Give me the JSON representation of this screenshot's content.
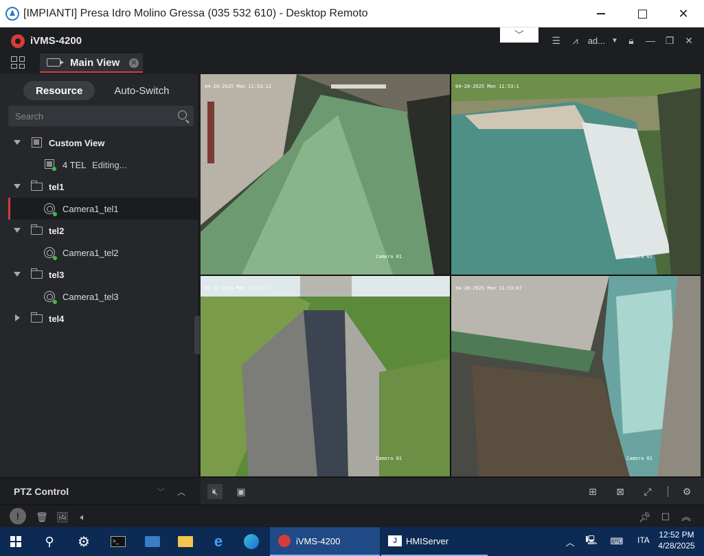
{
  "remote_window": {
    "title": "[IMPIANTI] Presa Idro Molino Gressa (035 532 610) - Desktop Remoto",
    "controls": [
      "minimize-icon",
      "maximize-icon",
      "close-icon"
    ]
  },
  "app": {
    "name": "iVMS-4200",
    "user": "ad...",
    "tab": {
      "label": "Main View"
    }
  },
  "sidebar": {
    "segments": [
      {
        "label": "Resource",
        "active": true
      },
      {
        "label": "Auto-Switch",
        "active": false
      }
    ],
    "search": {
      "placeholder": "Search",
      "value": ""
    },
    "tree": [
      {
        "type": "group",
        "label": "Custom View",
        "icon": "view-icon",
        "expanded": true
      },
      {
        "type": "view",
        "label": "4 TEL",
        "status": "Editing..."
      },
      {
        "type": "group",
        "label": "tel1",
        "icon": "folder-icon",
        "expanded": true
      },
      {
        "type": "camera",
        "label": "Camera1_tel1",
        "selected": true
      },
      {
        "type": "group",
        "label": "tel2",
        "icon": "folder-icon",
        "expanded": true
      },
      {
        "type": "camera",
        "label": "Camera1_tel2"
      },
      {
        "type": "group",
        "label": "tel3",
        "icon": "folder-icon",
        "expanded": true
      },
      {
        "type": "camera",
        "label": "Camera1_tel3"
      },
      {
        "type": "group",
        "label": "tel4",
        "icon": "folder-icon",
        "expanded": false
      }
    ],
    "ptz": {
      "label": "PTZ Control"
    }
  },
  "video": {
    "tiles": [
      {
        "timestamp": "04-28-2025 Mon 11:53:12",
        "camera": "Camera 01"
      },
      {
        "timestamp": "04-28-2025 Mon 11:53:1",
        "camera": "Camera 01"
      },
      {
        "timestamp": "04-28-2025 Mon 11:53:?",
        "camera": "Camera 01"
      },
      {
        "timestamp": "04-28-2025 Mon 11:53:07",
        "camera": "Camera 01"
      }
    ],
    "selected_tile": 2
  },
  "taskbar": {
    "apps": [
      {
        "label": "iVMS-4200",
        "active": true
      },
      {
        "label": "HMIServer",
        "active": false
      }
    ],
    "language": "ITA",
    "time": "12:52 PM",
    "date": "4/28/2025"
  },
  "colors": {
    "accent": "#d63b3b",
    "app_bg": "#1f2124",
    "taskbar": "#0c2a54"
  }
}
